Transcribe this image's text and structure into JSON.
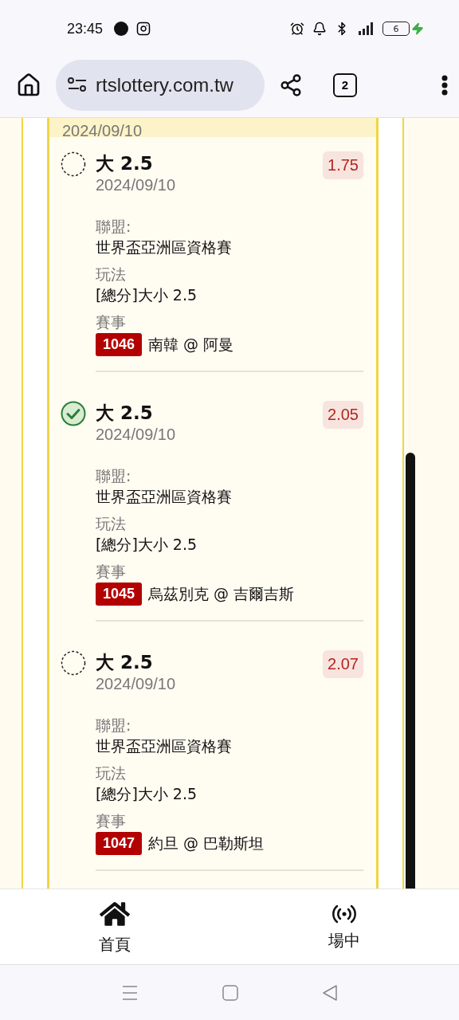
{
  "status_bar": {
    "time": "23:45",
    "battery": "6"
  },
  "browser": {
    "url": "rtslottery.com.tw",
    "tab_count": "2"
  },
  "section_header": {
    "date": "2024/09/10"
  },
  "bets": [
    {
      "pick": "大 2.5",
      "date": "2024/09/10",
      "odds": "1.75",
      "selected": false,
      "league_label": "聯盟:",
      "league": "世界盃亞洲區資格賽",
      "market_label": "玩法",
      "market": "[總分]大小 2.5",
      "match_label": "賽事",
      "match_no": "1046",
      "match": "南韓 @ 阿曼"
    },
    {
      "pick": "大 2.5",
      "date": "2024/09/10",
      "odds": "2.05",
      "selected": true,
      "league_label": "聯盟:",
      "league": "世界盃亞洲區資格賽",
      "market_label": "玩法",
      "market": "[總分]大小 2.5",
      "match_label": "賽事",
      "match_no": "1045",
      "match": "烏茲別克 @ 吉爾吉斯"
    },
    {
      "pick": "大 2.5",
      "date": "2024/09/10",
      "odds": "2.07",
      "selected": false,
      "league_label": "聯盟:",
      "league": "世界盃亞洲區資格賽",
      "market_label": "玩法",
      "market": "[總分]大小 2.5",
      "match_label": "賽事",
      "match_no": "1047",
      "match": "約旦 @ 巴勒斯坦"
    }
  ],
  "bottom_nav": [
    {
      "label": "首頁",
      "kind": "home"
    },
    {
      "label": "場中",
      "kind": "live"
    }
  ]
}
